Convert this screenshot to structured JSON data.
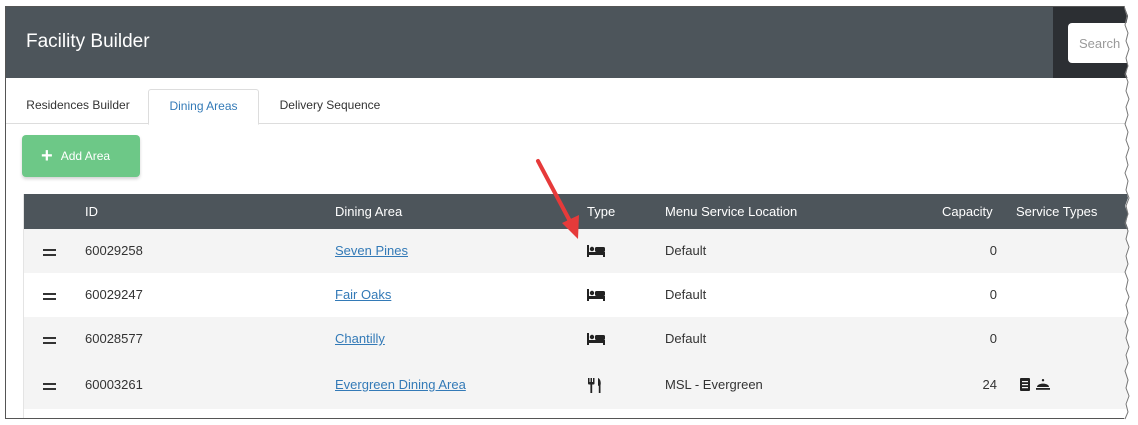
{
  "app": {
    "title": "Facility Builder"
  },
  "search": {
    "placeholder": "Search"
  },
  "tabs": [
    {
      "label": "Residences Builder",
      "active": false
    },
    {
      "label": "Dining Areas",
      "active": true
    },
    {
      "label": "Delivery Sequence",
      "active": false
    }
  ],
  "toolbar": {
    "add_label": "Add Area"
  },
  "table": {
    "headers": {
      "id": "ID",
      "dining_area": "Dining Area",
      "type": "Type",
      "menu_service_location": "Menu Service Location",
      "capacity": "Capacity",
      "service_types": "Service Types"
    },
    "rows": [
      {
        "id": "60029258",
        "dining_area": "Seven Pines",
        "type_icon": "bed-icon",
        "menu_service_location": "Default",
        "capacity": "0",
        "service_types": []
      },
      {
        "id": "60029247",
        "dining_area": "Fair Oaks",
        "type_icon": "bed-icon",
        "menu_service_location": "Default",
        "capacity": "0",
        "service_types": []
      },
      {
        "id": "60028577",
        "dining_area": "Chantilly",
        "type_icon": "bed-icon",
        "menu_service_location": "Default",
        "capacity": "0",
        "service_types": []
      },
      {
        "id": "60003261",
        "dining_area": "Evergreen Dining Area",
        "type_icon": "utensils-icon",
        "menu_service_location": "MSL - Evergreen",
        "capacity": "24",
        "service_types": [
          "menu-icon",
          "cloche-icon"
        ]
      }
    ]
  },
  "colors": {
    "header_bg": "#4d555b",
    "search_zone_bg": "#2c2f33",
    "accent_link": "#337ab7",
    "add_button": "#6dc887",
    "annotation_arrow": "#e63a3a"
  }
}
